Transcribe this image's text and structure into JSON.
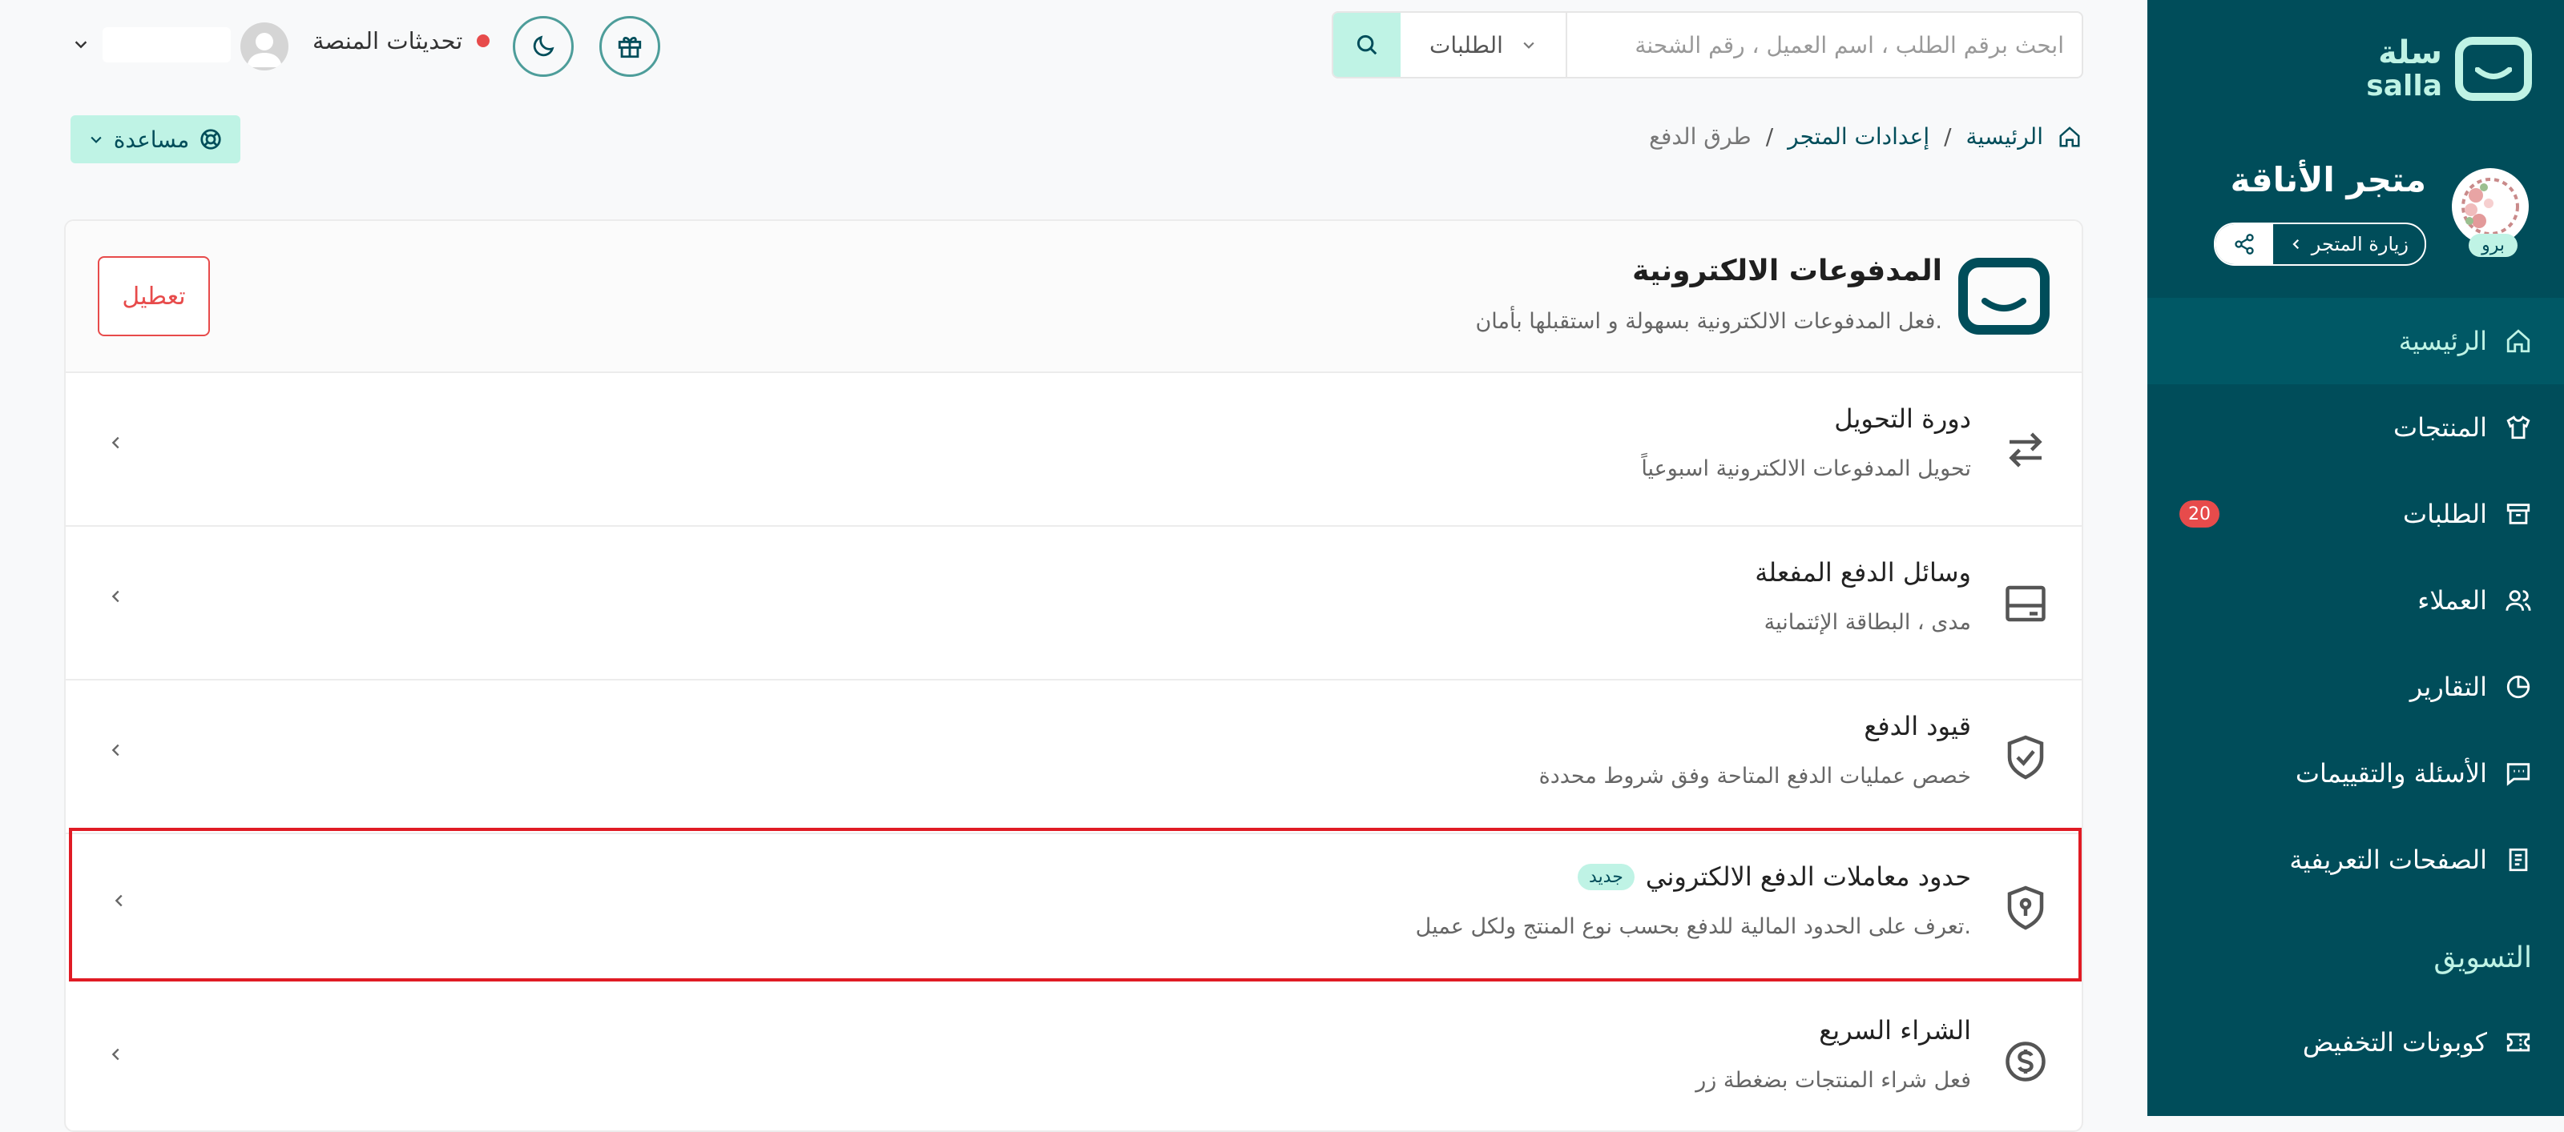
{
  "colors": {
    "sidebar": "#004d5a",
    "accent": "#bff3e5",
    "danger": "#e74b4b",
    "highlight_border": "#e01b24"
  },
  "sidebar": {
    "logo_ar": "سلة",
    "logo_en": "salla",
    "store_name": "متجر الأناقة",
    "store_badge": "برو",
    "visit_store": "زيارة المتجر",
    "items": [
      {
        "label": "الرئيسية",
        "icon": "home-icon",
        "active": true
      },
      {
        "label": "المنتجات",
        "icon": "shirt-icon"
      },
      {
        "label": "الطلبات",
        "icon": "archive-icon",
        "badge": "20"
      },
      {
        "label": "العملاء",
        "icon": "users-icon"
      },
      {
        "label": "التقارير",
        "icon": "pie-chart-icon"
      },
      {
        "label": "الأسئلة والتقييمات",
        "icon": "chat-icon"
      },
      {
        "label": "الصفحات التعريفية",
        "icon": "document-icon"
      }
    ],
    "section_title": "التسويق",
    "marketing_items": [
      {
        "label": "كوبونات التخفيض",
        "icon": "coupon-icon"
      }
    ]
  },
  "topbar": {
    "search_placeholder": "ابحث برقم الطلب ، اسم العميل ، رقم الشحنة",
    "search_type": "الطلبات",
    "platform_updates": "تحديثات المنصة"
  },
  "breadcrumb": {
    "home": "الرئيسية",
    "settings": "إعدادات المتجر",
    "current": "طرق الدفع",
    "separator": "/"
  },
  "help_label": "مساعدة",
  "card": {
    "title": "المدفوعات الالكترونية",
    "description": "فعل المدفوعات الالكترونية بسهولة و استقبلها بأمان.",
    "disable_label": "تعطيل",
    "rows": [
      {
        "title": "دورة التحويل",
        "description": "تحويل المدفوعات الالكترونية اسبوعياً",
        "icon": "transfer-arrows-icon"
      },
      {
        "title": "وسائل الدفع المفعلة",
        "description": "مدى ، البطاقة الإئتمانية",
        "icon": "card-icon"
      },
      {
        "title": "قيود الدفع",
        "description": "خصص عمليات الدفع المتاحة وفق شروط محددة",
        "icon": "shield-check-icon"
      },
      {
        "title": "حدود معاملات الدفع الالكتروني",
        "badge": "جديد",
        "description": "تعرف على الحدود المالية للدفع بحسب نوع المنتج ولكل عميل.",
        "icon": "shield-lock-icon"
      },
      {
        "title": "الشراء السريع",
        "description": "فعل شراء المنتجات بضغطة زر",
        "icon": "dollar-circle-icon"
      }
    ]
  }
}
